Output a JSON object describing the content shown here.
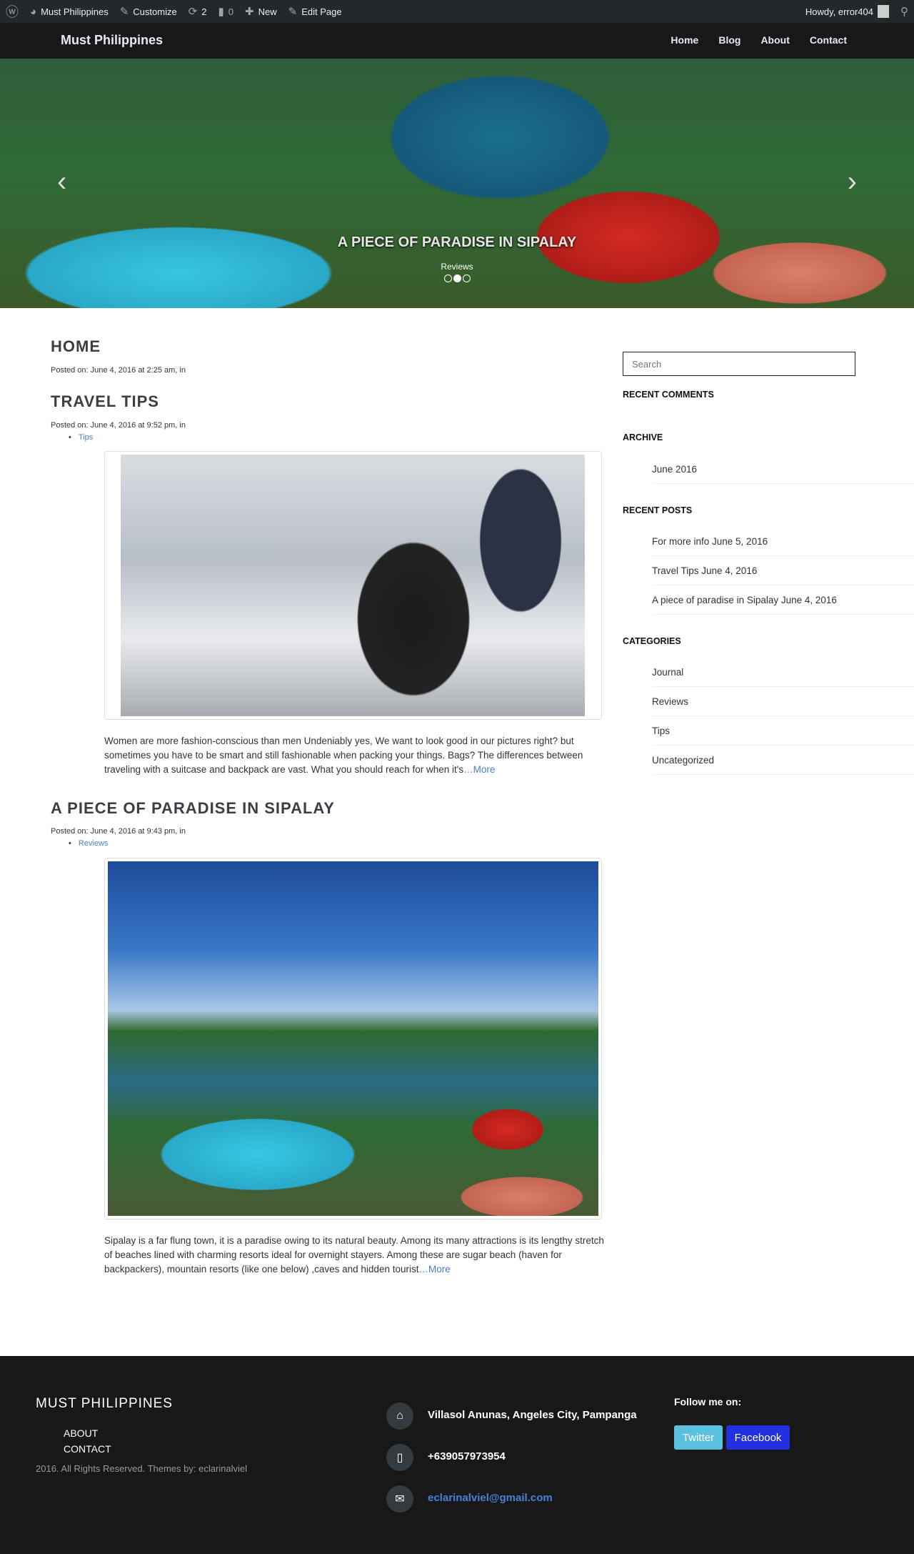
{
  "admin_bar": {
    "site": "Must Philippines",
    "customize": "Customize",
    "updates": "2",
    "comments": "0",
    "new": "New",
    "edit": "Edit Page",
    "howdy": "Howdy, error404"
  },
  "nav": {
    "brand": "Must Philippines",
    "items": [
      "Home",
      "Blog",
      "About",
      "Contact"
    ]
  },
  "hero": {
    "title": "A PIECE OF PARADISE IN SIPALAY",
    "category": "Reviews",
    "slides": 3,
    "active_slide": 2
  },
  "posts": [
    {
      "title": "HOME",
      "meta": "Posted on: June 4, 2016 at 2:25 am, in"
    },
    {
      "title": "TRAVEL TIPS",
      "meta": "Posted on: June 4, 2016 at 9:52 pm, in",
      "category": "Tips",
      "excerpt": "Women are more fashion-conscious than men Undeniably yes, We want to look good in our pictures right? but sometimes you have to be smart and still fashionable when packing your things. Bags? The differences between traveling with a suitcase and backpack are vast. What you should reach for when it's",
      "more": "…More"
    },
    {
      "title": "A PIECE OF PARADISE IN SIPALAY",
      "meta": "Posted on: June 4, 2016 at 9:43 pm, in",
      "category": "Reviews",
      "excerpt": "Sipalay is a far flung town, it is a paradise owing to its natural beauty. Among its many attractions is its lengthy stretch of beaches lined with charming resorts ideal for overnight stayers. Among these are sugar beach (haven for backpackers), mountain resorts (like one below) ,caves and hidden tourist",
      "more": "…More"
    }
  ],
  "sidebar": {
    "search_placeholder": "Search",
    "recent_comments": "RECENT COMMENTS",
    "archive": {
      "title": "ARCHIVE",
      "items": [
        "June 2016"
      ]
    },
    "recent_posts": {
      "title": "RECENT POSTS",
      "items": [
        "For more info June 5, 2016",
        "Travel Tips June 4, 2016",
        "A piece of paradise in Sipalay June 4, 2016"
      ]
    },
    "categories": {
      "title": "CATEGORIES",
      "items": [
        "Journal",
        "Reviews",
        "Tips",
        "Uncategorized"
      ]
    }
  },
  "footer": {
    "title": "MUST PHILIPPINES",
    "links": [
      "ABOUT",
      "CONTACT"
    ],
    "copyright": "2016. All Rights Reserved. Themes by: eclarinalviel",
    "address": "Villasol Anunas, Angeles City, Pampanga",
    "phone": "+639057973954",
    "email": "eclarinalviel@gmail.com",
    "follow": "Follow me on:",
    "twitter": "Twitter",
    "facebook": "Facebook",
    "twitter_color": "#5bc0de",
    "facebook_color": "#2230dd"
  }
}
